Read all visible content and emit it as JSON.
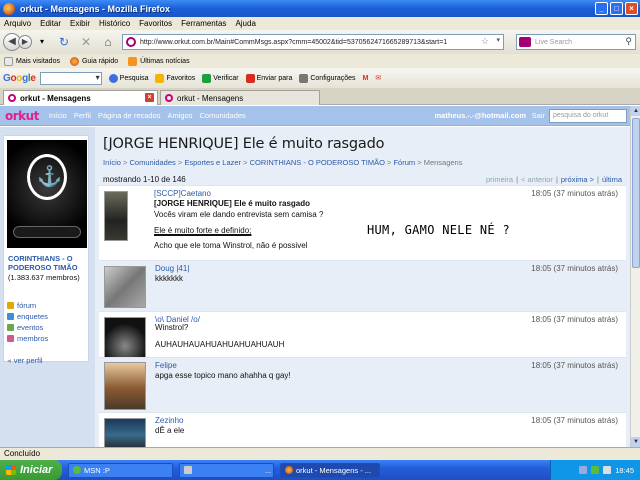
{
  "window": {
    "title": "orkut - Mensagens - Mozilla Firefox"
  },
  "menu": [
    "Arquivo",
    "Editar",
    "Exibir",
    "Histórico",
    "Favoritos",
    "Ferramentas",
    "Ajuda"
  ],
  "nav": {
    "url": "http://www.orkut.com.br/Main#CommMsgs.aspx?cmm=45002&tid=5370562471665289713&start=1",
    "search_placeholder": "Live Search"
  },
  "bookmarks": [
    "Mais visitados",
    "Guia rápido",
    "Últimas notícias"
  ],
  "google_toolbar": {
    "logo": "Google",
    "items": [
      "Pesquisa",
      "Favoritos",
      "Verificar",
      "Enviar para",
      "Configurações"
    ]
  },
  "tabs": [
    "orkut - Mensagens",
    "orkut - Mensagens"
  ],
  "orkut": {
    "logo": "orkut",
    "nav": [
      "Início",
      "Perfil",
      "Página de recados",
      "Amigos",
      "Comunidades"
    ],
    "user": "matheus.-.-@hotmail.com",
    "sair": "Sair",
    "search_placeholder": "pesquisa do orkut"
  },
  "sidebar": {
    "community_name": "CORINTHIANS - O PODEROSO TIMÃO",
    "members": "(1.383.637 membros)",
    "links": [
      "fórum",
      "enquetes",
      "eventos",
      "membros"
    ],
    "ver_perfil": "ver perfil"
  },
  "page": {
    "title": "[JORGE HENRIQUE] Ele é muito rasgado",
    "breadcrumb": [
      "Início",
      "Comunidades",
      "Esportes e Lazer",
      "CORINTHIANS - O PODEROSO TIMÃO",
      "Fórum",
      "Mensagens"
    ],
    "showing": "mostrando 1-10 de 146",
    "pager": [
      "primeira",
      "< anterior",
      "próxima >",
      "última"
    ]
  },
  "posts": [
    {
      "author": "[SCCP]Caetano",
      "time": "18:05 (37 minutos atrás)",
      "lines": [
        "[JORGE HENRIQUE] Ele é muito rasgado",
        "Vocês viram ele dando entrevista sem camisa ?",
        "",
        "Ele é muito forte e definido;",
        "",
        "Acho que ele toma Winstrol, não é possivel"
      ]
    },
    {
      "author": "Doug |41|",
      "time": "18:05 (37 minutos atrás)",
      "lines": [
        "kkkkkkk"
      ]
    },
    {
      "author": "\\o\\ Daniel /o/",
      "time": "18:05 (37 minutos atrás)",
      "lines": [
        "Winstrol?",
        "",
        "AUHAUHAUAHUAHUAHUAHUAUH"
      ]
    },
    {
      "author": "Felipe",
      "time": "18:05 (37 minutos atrás)",
      "lines": [
        "apga esse topico mano ahahha q gay!"
      ]
    },
    {
      "author": "Zezinho",
      "time": "18:05 (37 minutos atrás)",
      "lines": [
        "dÊ a ele"
      ]
    }
  ],
  "annotation": "HUM, GAMO NELE NÉ ?",
  "status": "Concluído",
  "taskbar": {
    "start": "Iniciar",
    "tasks": [
      "MSN :P",
      "...",
      "orkut - Mensagens - ..."
    ],
    "lang": "PT",
    "clock": "18:45"
  }
}
